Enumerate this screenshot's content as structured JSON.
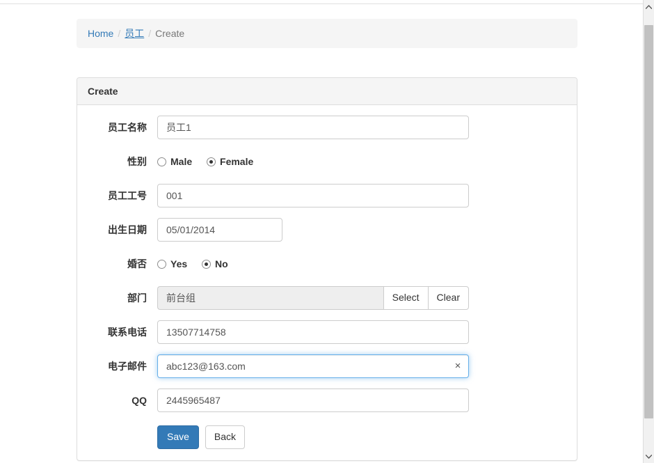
{
  "breadcrumb": {
    "home_label": "Home",
    "section_label": "员工",
    "current_label": "Create",
    "separator": "/"
  },
  "panel": {
    "title": "Create"
  },
  "form": {
    "name": {
      "label": "员工名称",
      "value": "员工1"
    },
    "gender": {
      "label": "性别",
      "options": [
        {
          "label": "Male",
          "checked": false
        },
        {
          "label": "Female",
          "checked": true
        }
      ]
    },
    "employee_no": {
      "label": "员工工号",
      "value": "001"
    },
    "birthdate": {
      "label": "出生日期",
      "value": "05/01/2014"
    },
    "married": {
      "label": "婚否",
      "options": [
        {
          "label": "Yes",
          "checked": false
        },
        {
          "label": "No",
          "checked": true
        }
      ]
    },
    "department": {
      "label": "部门",
      "value": "前台组",
      "select_label": "Select",
      "clear_label": "Clear"
    },
    "phone": {
      "label": "联系电话",
      "value": "13507714758"
    },
    "email": {
      "label": "电子邮件",
      "value": "abc123@163.com",
      "clear_icon": "×"
    },
    "qq": {
      "label": "QQ",
      "value": "2445965487"
    }
  },
  "actions": {
    "save_label": "Save",
    "back_label": "Back"
  },
  "scrollbar": {
    "up_icon": "⌃",
    "down_icon": "⌄"
  },
  "colors": {
    "primary": "#337ab7",
    "link": "#337ab7",
    "focus_border": "#66afe9",
    "panel_border": "#dddddd",
    "heading_bg": "#f5f5f5"
  }
}
